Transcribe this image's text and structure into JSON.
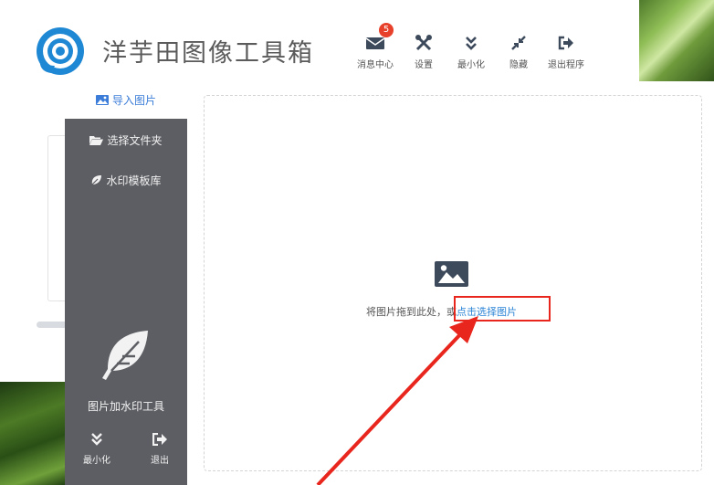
{
  "app": {
    "title": "洋芋田图像工具箱"
  },
  "toolbar": {
    "messages": {
      "label": "消息中心",
      "badge": "5",
      "icon": "envelope-icon"
    },
    "settings": {
      "label": "设置",
      "icon": "tools-icon"
    },
    "minimize": {
      "label": "最小化",
      "icon": "double-chevron-down-icon"
    },
    "hide": {
      "label": "隐藏",
      "icon": "compress-icon"
    },
    "exit": {
      "label": "退出程序",
      "icon": "sign-out-icon"
    }
  },
  "sidebar": {
    "items": [
      {
        "label": "导入图片",
        "icon": "picture-icon",
        "active": true
      },
      {
        "label": "选择文件夹",
        "icon": "folder-open-icon",
        "active": false
      },
      {
        "label": "水印模板库",
        "icon": "leaf-icon",
        "active": false
      }
    ],
    "brand_name": "图片加水印工具",
    "minimize_label": "最小化",
    "exit_label": "退出"
  },
  "dropzone": {
    "hint": "将图片拖到此处，",
    "or": "或",
    "link": "点击选择图片"
  },
  "colors": {
    "accent": "#2b84d6",
    "sidebar": "#5d5e63",
    "badge": "#e8412b",
    "highlight": "#e8261d"
  }
}
